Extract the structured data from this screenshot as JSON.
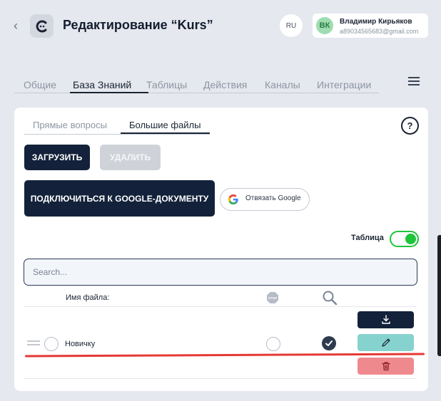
{
  "header": {
    "title": "Редактирование “Kurs”",
    "lang": "RU",
    "user": {
      "initials": "ВК",
      "name": "Владимир Кирьяков",
      "email": "a89034565683@gmail.com"
    }
  },
  "tabs": [
    {
      "label": "Общие"
    },
    {
      "label": "База Знаний",
      "active": true
    },
    {
      "label": "Таблицы"
    },
    {
      "label": "Действия"
    },
    {
      "label": "Каналы"
    },
    {
      "label": "Интеграции"
    }
  ],
  "panel": {
    "subtabs": [
      {
        "label": "Прямые вопросы"
      },
      {
        "label": "Большие файлы",
        "active": true
      }
    ],
    "help": "?",
    "upload_label": "ЗАГРУЗИТЬ",
    "delete_label": "УДАЛИТЬ",
    "google_connect_label": "ПОДКЛЮЧИТЬСЯ К GOOGLE-ДОКУМЕНТУ",
    "google_unlink_label": "Отвязать Google",
    "table_toggle_label": "Таблица",
    "table_toggle_on": true,
    "search_placeholder": "Search...",
    "columns": {
      "file_name": "Имя файла:"
    },
    "rows": [
      {
        "name": "Новичку",
        "stop": false,
        "search": true
      }
    ]
  },
  "colors": {
    "primary": "#13223a",
    "toggle": "#1ec43b",
    "edit": "#86d2cf",
    "delete": "#ee8a8e",
    "annotation": "#e53935"
  }
}
